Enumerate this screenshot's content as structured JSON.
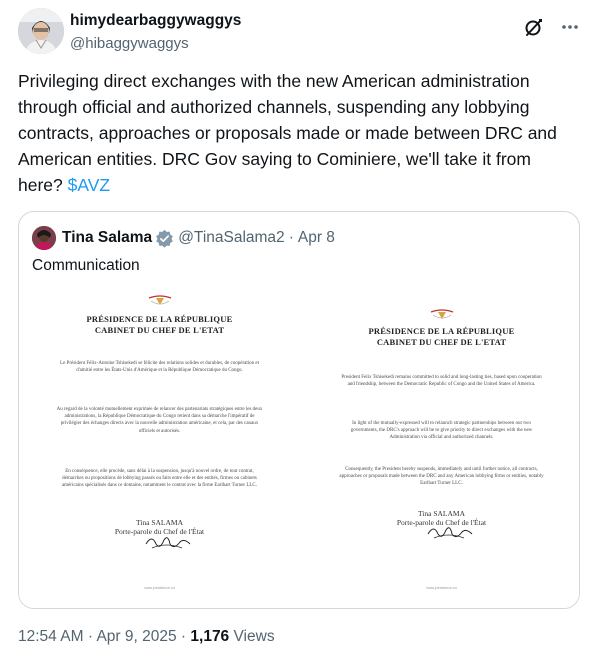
{
  "author": {
    "display_name": "himydearbaggywaggys",
    "handle": "@hibaggywaggys"
  },
  "tweet": {
    "text": "Privileging direct exchanges with the new American administration through official and authorized channels, suspending any lobbying contracts, approaches or proposals made or made between DRC and American entities. DRC Gov saying to Cominiere, we'll take it from here? ",
    "cashtag": "$AVZ"
  },
  "icons": {
    "grok": "grok-icon",
    "more": "more-icon",
    "verified": "verified-badge-icon"
  },
  "colors": {
    "accent": "#1d9bf0",
    "secondary_text": "#536471",
    "border": "#cfd9de"
  },
  "quote": {
    "display_name": "Tina Salama",
    "handle": "@TinaSalama2",
    "separator": "·",
    "date": "Apr 8",
    "text": "Communication",
    "documents": [
      {
        "title_line1": "PRÉSIDENCE DE LA RÉPUBLIQUE",
        "title_line2": "CABINET DU CHEF DE L'ETAT",
        "paragraphs": [
          "Le Président Félix-Antoine Tshisekedi se félicite des relations solides et durables, de coopération et d'amitié entre les États-Unis d'Amérique et la République Démocratique du Congo.",
          "Au regard de la volonté mutuellement exprimée de relancer des partenariats stratégiques entre les deux administrations, la République Démocratique du Congo retient dans sa démarche l'impératif de privilégier des échanges directs avec la nouvelle administration américaine, et cela, par des canaux officiels et autorisés.",
          "En conséquence, elle procède, sans délai à la suspension, jusqu'à nouvel ordre, de tout contrat, démarches ou propositions de lobbying passés ou faits entre elle et des entités, firmes ou cabinets américains spécialisés dans ce domaine, notamment le contrat avec la firme Earlhart Turner LLC."
        ],
        "signer_name": "Tina SALAMA",
        "signer_role": "Porte-parole du Chef de l'État",
        "footer": "www.presidence.cd"
      },
      {
        "title_line1": "PRÉSIDENCE DE LA RÉPUBLIQUE",
        "title_line2": "CABINET DU CHEF DE L'ETAT",
        "paragraphs": [
          "President Felix Tshisekedi remains committed to solid and long-lasting ties, based upon cooperation and friendship, between the Democratic Republic of Congo and the United States of America.",
          "In light of the mutually-expressed will to relaunch strategic partnerships between our two governments, the DRC's approach will be to give priority to direct exchanges with the new Administration via official and authorized channels.",
          "Consequently, the President hereby suspends, immediately and until further notice, all contracts, approaches or proposals made between the DRC and any American lobbying firms or entities, notably Earlhart Turner LLC."
        ],
        "signer_name": "Tina SALAMA",
        "signer_role": "Porte-parole du Chef de l'État",
        "footer": "www.presidence.cd"
      }
    ]
  },
  "meta": {
    "time": "12:54 AM",
    "separator": "·",
    "date": "Apr 9, 2025",
    "views_count": "1,176",
    "views_label": "Views"
  }
}
